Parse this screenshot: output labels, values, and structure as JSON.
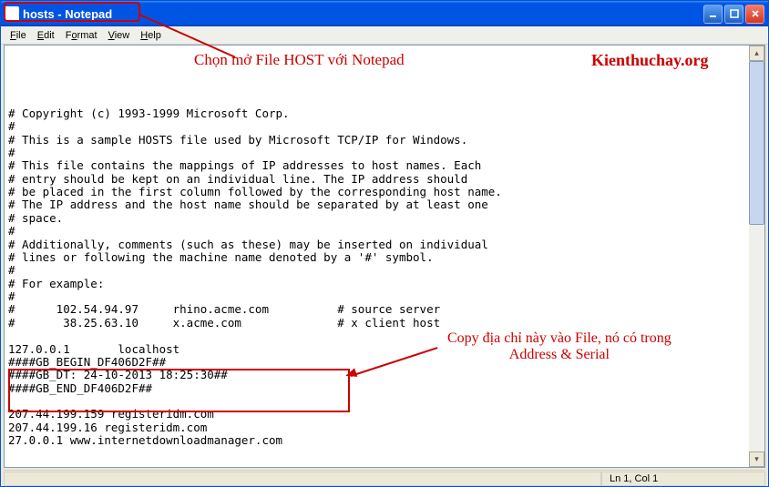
{
  "window": {
    "title": "hosts - Notepad"
  },
  "menu": {
    "file": "File",
    "edit": "Edit",
    "format": "Format",
    "view": "View",
    "help": "Help"
  },
  "annotations": {
    "top_center": "Chọn mở File HOST với Notepad",
    "top_right": "Kienthuchay.org",
    "mid_right_1": "Copy địa chỉ này vào File, nó có trong",
    "mid_right_2": "Address & Serial"
  },
  "content": "# Copyright (c) 1993-1999 Microsoft Corp.\n#\n# This is a sample HOSTS file used by Microsoft TCP/IP for Windows.\n#\n# This file contains the mappings of IP addresses to host names. Each\n# entry should be kept on an individual line. The IP address should\n# be placed in the first column followed by the corresponding host name.\n# The IP address and the host name should be separated by at least one\n# space.\n#\n# Additionally, comments (such as these) may be inserted on individual\n# lines or following the machine name denoted by a '#' symbol.\n#\n# For example:\n#\n#      102.54.94.97     rhino.acme.com          # source server\n#       38.25.63.10     x.acme.com              # x client host\n\n127.0.0.1       localhost\n####GB_BEGIN_DF406D2F##\n####GB_DT: 24-10-2013 18:25:30##\n####GB_END_DF406D2F##\n\n207.44.199.159 registeridm.com\n207.44.199.16 registeridm.com\n27.0.0.1 www.internetdownloadmanager.com",
  "status": {
    "position": "Ln 1, Col 1"
  }
}
